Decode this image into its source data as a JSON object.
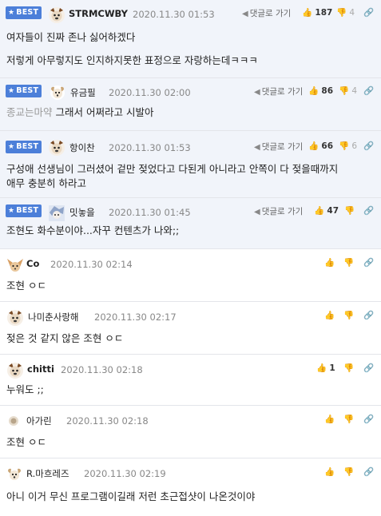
{
  "ui": {
    "best_label": "BEST",
    "reply_label": "댓글로 가기"
  },
  "colors": {
    "best_badge": "#4c7fd9",
    "best_background": "#f1f4fa",
    "date_gray": "#888888"
  },
  "comments": [
    {
      "best": true,
      "nick": "STRMCWBY",
      "date": "2020.11.30 01:53",
      "likes": "187",
      "dislikes": "4",
      "avatar": "dog-face-icon",
      "lines": [
        "여자들이 진짜 존나 싫어하겠다",
        "",
        "저렇게 아무렇지도 인지하지못한 표정으로 자랑하는데ㅋㅋㅋ"
      ]
    },
    {
      "best": true,
      "nick": "유금필",
      "date": "2020.11.30 02:00",
      "likes": "86",
      "dislikes": "4",
      "avatar": "puppy-face-icon",
      "prefix": "종교는마약",
      "lines": [
        "그래서 어쩌라고 시발아"
      ]
    },
    {
      "best": true,
      "nick": "항이찬",
      "date": "2020.11.30 01:53",
      "likes": "66",
      "dislikes": "6",
      "avatar": "dog-face-icon",
      "lines": [
        "구성애 선생님이 그러셨어 겉만 젖었다고 다된게 아니라고 안쪽이 다 젖을때까지",
        "애무 충분히 하라고"
      ]
    },
    {
      "best": true,
      "nick": "밋놓을",
      "date": "2020.11.30 01:45",
      "likes": "47",
      "dislikes": "",
      "avatar": "anime-avatar-icon",
      "lines": [
        "조현도 화수분이야...자꾸 컨텐츠가 나와;;"
      ]
    },
    {
      "best": false,
      "nick": "Co",
      "date": "2020.11.30 02:14",
      "likes": "",
      "dislikes": "",
      "avatar": "chihuahua-icon",
      "lines": [
        "조현 ㅇㄷ"
      ]
    },
    {
      "best": false,
      "nick": "나미춘사랑해",
      "date": "2020.11.30 02:17",
      "likes": "",
      "dislikes": "",
      "avatar": "dog-face-icon",
      "lines": [
        "젖은 것 같지 않은 조현 ㅇㄷ"
      ]
    },
    {
      "best": false,
      "nick": "chitti",
      "date": "2020.11.30 02:18",
      "likes": "1",
      "dislikes": "",
      "avatar": "dog-face-icon",
      "lines": [
        "누워도 ;;"
      ]
    },
    {
      "best": false,
      "nick": "아가린",
      "date": "2020.11.30 02:18",
      "likes": "",
      "dislikes": "",
      "avatar": "small-dot-avatar-icon",
      "lines": [
        "조현 ㅇㄷ"
      ]
    },
    {
      "best": false,
      "nick": "R.마흐레즈",
      "date": "2020.11.30 02:19",
      "likes": "",
      "dislikes": "",
      "avatar": "puppy-face-icon",
      "lines": [
        "아니 이거 무신 프로그램이길래 저런 초근접샷이 나온것이야"
      ]
    }
  ]
}
